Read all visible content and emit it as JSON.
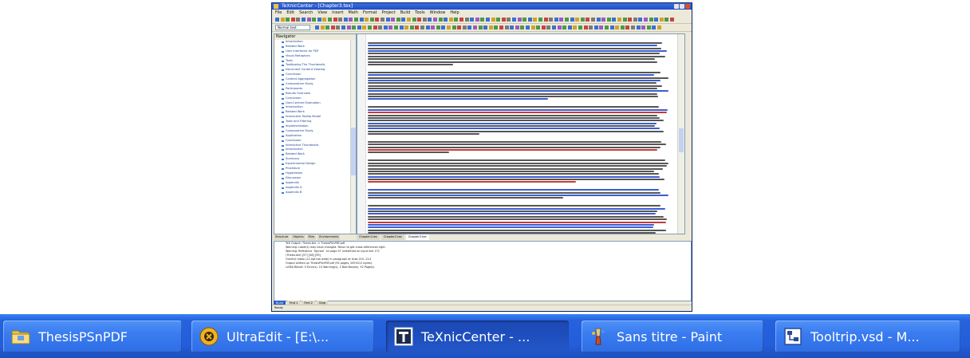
{
  "window": {
    "title": "TeXnicCenter - [Chapter3.tex]",
    "menu": [
      "File",
      "Edit",
      "Search",
      "View",
      "Insert",
      "Math",
      "Format",
      "Project",
      "Build",
      "Tools",
      "Window",
      "Help"
    ],
    "format_combo": "Normal text"
  },
  "navigator": {
    "title": "Navigator",
    "items": [
      "Introduction",
      "Related Work",
      "User Interfaces for PDF",
      "Visual Metaphors",
      "Tools",
      "Tooltipping The Thumbnails",
      "Document Content Viewing",
      "Conclusion",
      "Content Aggregation",
      "Comparative Study",
      "Participants",
      "Results Overview",
      "Conclusion",
      "User-Centred Evaluation",
      "Introduction",
      "Related Work",
      "Interactive Tooltip Model",
      "Tools and Filtering",
      "Implementation",
      "Comparative Study",
      "Application",
      "Conclusion",
      "Interactive Thumbnails",
      "Introduction",
      "Related Work",
      "Summary",
      "Experimental Design",
      "Procedure",
      "Hypotheses",
      "Discussion",
      "Appendix",
      "Appendix A",
      "Appendix B"
    ]
  },
  "left_tabs": [
    "Structure",
    "Objects",
    "Files",
    "Environments"
  ],
  "doc_tabs": [
    "Chapter1.tex",
    "Chapter2.tex",
    "Chapter3.tex"
  ],
  "output": {
    "lines": [
      "TeX Output: Thesis.tex -> ThesisPSnPDF.pdf",
      "Warning: Label(s) may have changed. Rerun to get cross-references right.",
      "Warning: Reference `fig:tool` on page 57 undefined on input line 172",
      "(Thesis.bbl) [57] [58] [59]",
      "Overfull \\hbox (12.4pt too wide) in paragraph at lines 210--214",
      "Output written on ThesisPSnPDF.pdf (92 pages, 2874311 bytes).",
      "LaTeX-Result: 0 Error(s), 10 Warning(s), 2 Bad Box(es), 92 Page(s)"
    ],
    "tabs": [
      "Build",
      "Find 1",
      "Find 2",
      "Grep"
    ]
  },
  "statusbar": "Ready",
  "taskbar": {
    "buttons": [
      {
        "label": "ThesisPSnPDF",
        "icon": "folder-icon",
        "active": false
      },
      {
        "label": "UltraEdit - [E:\\...",
        "icon": "ultraedit-icon",
        "active": false
      },
      {
        "label": "TeXnicCenter - ...",
        "icon": "texniccenter-icon",
        "active": true
      },
      {
        "label": "Sans titre - Paint",
        "icon": "paint-icon",
        "active": false
      },
      {
        "label": "Tooltrip.vsd - M...",
        "icon": "visio-icon",
        "active": false
      }
    ]
  },
  "colors": {
    "taskbar": "#245edb",
    "button": "#3a7cf0",
    "button_active": "#1e4fbe",
    "title_bar": "#1c4fc8"
  }
}
